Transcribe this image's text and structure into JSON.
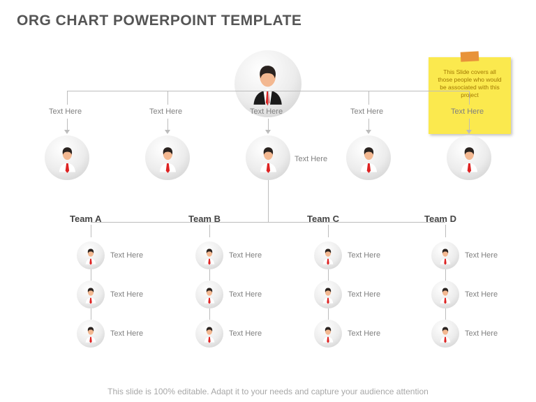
{
  "title": "ORG CHART POWERPOINT TEMPLATE",
  "sticky": "This Slide covers all those people who would be associated with this project",
  "l2": [
    {
      "label": "Text Here"
    },
    {
      "label": "Text Here"
    },
    {
      "label": "Text Here"
    },
    {
      "label": "Text Here"
    },
    {
      "label": "Text Here"
    }
  ],
  "mid_label": "Text Here",
  "teams": [
    {
      "name": "Team A",
      "members": [
        "Text Here",
        "Text Here",
        "Text Here"
      ]
    },
    {
      "name": "Team B",
      "members": [
        "Text Here",
        "Text Here",
        "Text Here"
      ]
    },
    {
      "name": "Team C",
      "members": [
        "Text Here",
        "Text Here",
        "Text Here"
      ]
    },
    {
      "name": "Team D",
      "members": [
        "Text Here",
        "Text Here",
        "Text Here"
      ]
    }
  ],
  "footer": "This slide is 100% editable. Adapt it to your needs and capture your audience attention"
}
